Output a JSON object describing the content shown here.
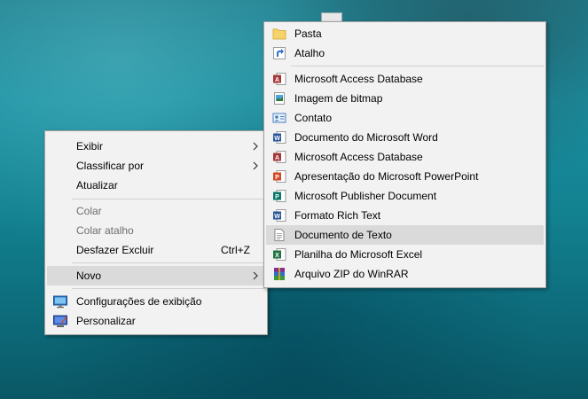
{
  "context_menu": {
    "items": [
      {
        "label": "Exibir"
      },
      {
        "label": "Classificar por"
      },
      {
        "label": "Atualizar"
      },
      {
        "label": "Colar"
      },
      {
        "label": "Colar atalho"
      },
      {
        "label": "Desfazer Excluir",
        "shortcut": "Ctrl+Z"
      },
      {
        "label": "Novo"
      },
      {
        "label": "Configurações de exibição",
        "icon": "display-settings-icon"
      },
      {
        "label": "Personalizar",
        "icon": "personalize-icon"
      }
    ]
  },
  "submenu": {
    "items": [
      {
        "label": "Pasta",
        "icon": "folder-icon"
      },
      {
        "label": "Atalho",
        "icon": "shortcut-icon"
      },
      {
        "label": "Microsoft Access Database",
        "icon": "access-icon"
      },
      {
        "label": "Imagem de bitmap",
        "icon": "bitmap-icon"
      },
      {
        "label": "Contato",
        "icon": "contact-icon"
      },
      {
        "label": "Documento do Microsoft Word",
        "icon": "word-icon"
      },
      {
        "label": "Microsoft Access Database",
        "icon": "access-icon"
      },
      {
        "label": "Apresentação do Microsoft PowerPoint",
        "icon": "powerpoint-icon"
      },
      {
        "label": "Microsoft Publisher Document",
        "icon": "publisher-icon"
      },
      {
        "label": "Formato Rich Text",
        "icon": "rtf-icon"
      },
      {
        "label": "Documento de Texto",
        "icon": "text-document-icon"
      },
      {
        "label": "Planilha do Microsoft Excel",
        "icon": "excel-icon"
      },
      {
        "label": "Arquivo ZIP do WinRAR",
        "icon": "winrar-icon"
      }
    ]
  }
}
